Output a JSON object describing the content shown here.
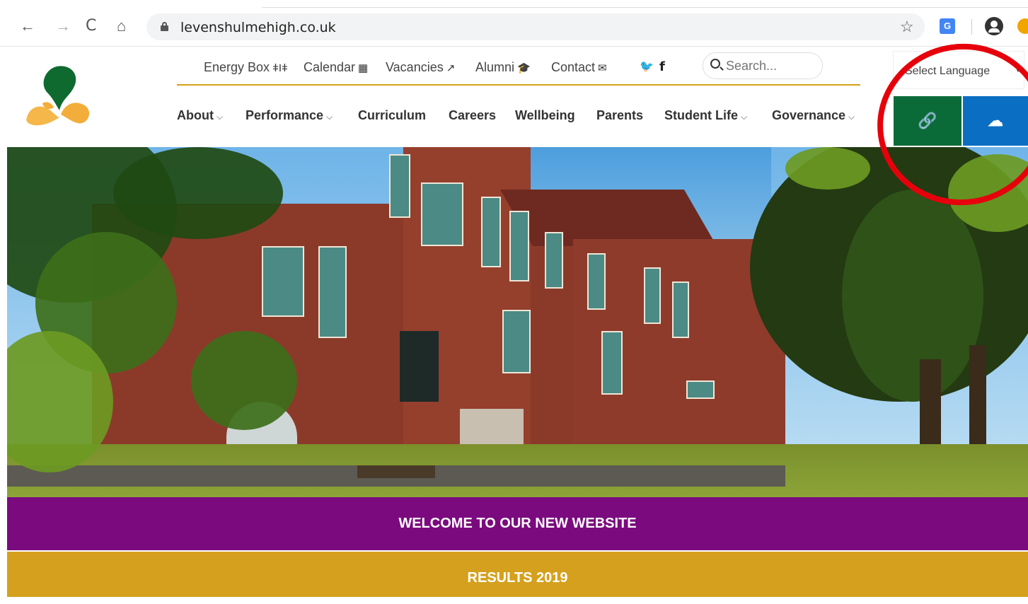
{
  "browser": {
    "back": "←",
    "forward": "→",
    "reload": "C",
    "home": "⌂",
    "url": "levenshulmehigh.co.uk",
    "bookmark": "☆",
    "translate_badge": "G"
  },
  "toplinks": [
    {
      "label": "Energy Box",
      "icon": "ǂIǂ"
    },
    {
      "label": "Calendar",
      "icon": "▦"
    },
    {
      "label": "Vacancies",
      "icon": "↗"
    },
    {
      "label": "Alumni",
      "icon": "🎓"
    },
    {
      "label": "Contact",
      "icon": "✉"
    }
  ],
  "social": {
    "twitter": "🐦",
    "facebook": "f"
  },
  "search": {
    "placeholder": "Search..."
  },
  "mainnav": [
    {
      "label": "About",
      "dropdown": true
    },
    {
      "label": "Performance",
      "dropdown": true
    },
    {
      "label": "Curriculum",
      "dropdown": false
    },
    {
      "label": "Careers",
      "dropdown": false
    },
    {
      "label": "Wellbeing",
      "dropdown": false
    },
    {
      "label": "Parents",
      "dropdown": false
    },
    {
      "label": "Student Life",
      "dropdown": true
    },
    {
      "label": "Governance",
      "dropdown": true
    }
  ],
  "chevron": "⌵",
  "language": {
    "label": "Select Language",
    "arrow": "▼"
  },
  "quick_buttons": {
    "link_icon": "🔗",
    "blue_icon": "☁"
  },
  "banners": {
    "welcome": "WELCOME TO OUR NEW WEBSITE",
    "results": "RESULTS 2019"
  },
  "colors": {
    "purple": "#7b0a7f",
    "gold": "#d5a01d",
    "green": "#0b6b38",
    "blue": "#0a6fc2",
    "annotation": "#e6000b"
  }
}
